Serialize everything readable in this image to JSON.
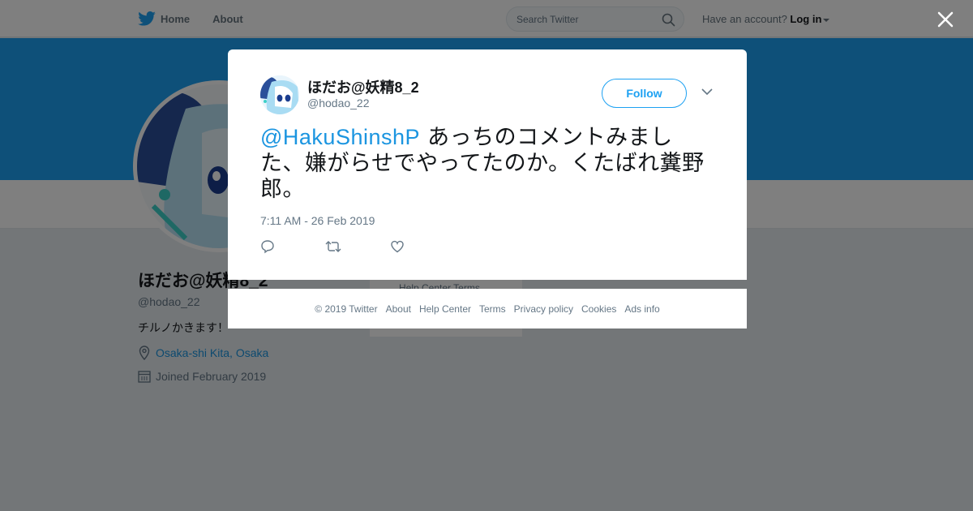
{
  "nav": {
    "home_label": "Home",
    "about_label": "About",
    "search_placeholder": "Search Twitter",
    "have_account_label": "Have an account?",
    "login_label": "Log in"
  },
  "profile": {
    "name": "ほだお@妖精8_2",
    "handle": "@hodao_22",
    "bio": "チルノかきます！",
    "location": "Osaka-shi Kita, Osaka",
    "joined": "Joined February 2019",
    "side_links": "Help Center  Terms"
  },
  "tweet": {
    "name": "ほだお@妖精8_2",
    "handle": "@hodao_22",
    "follow_label": "Follow",
    "mention": "@HakuShinshP",
    "text": " あっちのコメントみました、嫌がらせでやってたのか。くたばれ糞野郎。",
    "timestamp": "7:11 AM - 26 Feb 2019"
  },
  "footer": {
    "links": [
      "© 2019 Twitter",
      "About",
      "Help Center",
      "Terms",
      "Privacy policy",
      "Cookies",
      "Ads info"
    ]
  },
  "colors": {
    "brand": "#1da1f2",
    "link": "#1b95e0",
    "secondary_text": "#657786"
  }
}
